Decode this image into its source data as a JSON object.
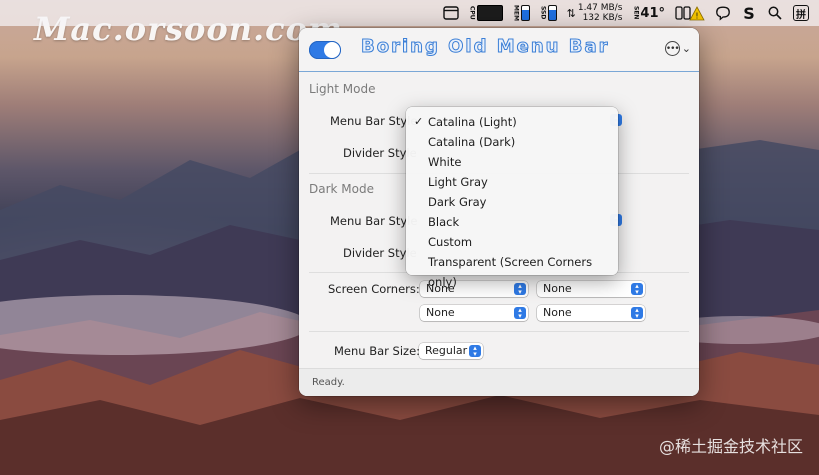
{
  "watermarks": {
    "top": "Mac.orsoon.com",
    "bottom": "@稀土掘金技术社区"
  },
  "menubar": {
    "cpu_label": "CPU",
    "mem_label": "MEM",
    "ssd_label": "SSD",
    "net_up": "1.47 MB/s",
    "net_down": "132 KB/s",
    "sen_label": "SEN",
    "temperature": "41°",
    "ime_char": "拼"
  },
  "app": {
    "title": "Boring Old Menu Bar",
    "enabled": true,
    "light_mode": {
      "section_title": "Light Mode",
      "menu_bar_style_label": "Menu Bar Style",
      "divider_style_label": "Divider Style"
    },
    "dark_mode": {
      "section_title": "Dark Mode",
      "menu_bar_style_label": "Menu Bar Style",
      "divider_style_label": "Divider Style"
    },
    "screen_corners": {
      "label": "Screen Corners:",
      "top_left": "None",
      "top_right": "None",
      "bottom_left": "None",
      "bottom_right": "None"
    },
    "menu_bar_size": {
      "label": "Menu Bar Size:",
      "value": "Regular"
    },
    "status": "Ready."
  },
  "dropdown": {
    "selected_index": 0,
    "items": [
      "Catalina (Light)",
      "Catalina (Dark)",
      "White",
      "Light Gray",
      "Dark Gray",
      "Black",
      "Custom",
      "Transparent (Screen Corners only)"
    ]
  },
  "colors": {
    "accent": "#2f7ae5",
    "title_outline": "#3c7fd6"
  }
}
